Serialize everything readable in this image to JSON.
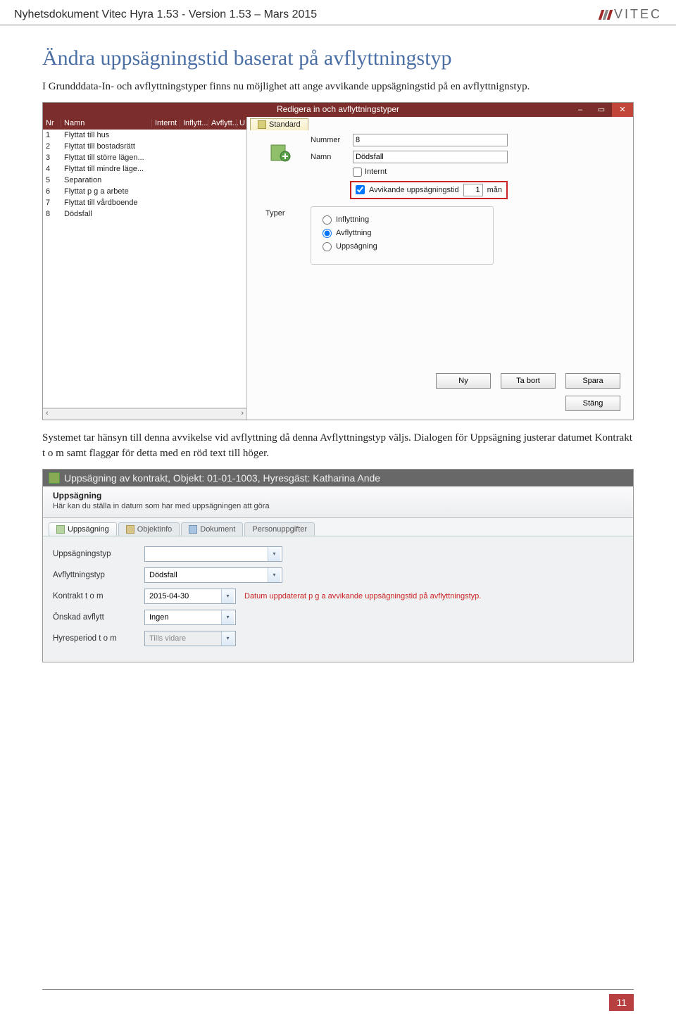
{
  "header": {
    "doc_title": "Nyhetsdokument Vitec Hyra 1.53 - Version 1.53 – Mars 2015",
    "logo_text": "VITEC"
  },
  "section_title": "Ändra uppsägningstid baserat på avflyttningstyp",
  "intro_text": "I Grundddata-In- och avflyttningstyper finns nu möjlighet att ange avvikande uppsägningstid på en avflyttnignstyp.",
  "shot1": {
    "title": "Redigera in och avflyttningstyper",
    "cols": {
      "nr": "Nr",
      "namn": "Namn",
      "internt": "Internt",
      "inflytt": "Inflytt...",
      "avflytt": "Avflytt...",
      "u": "U"
    },
    "rows": [
      {
        "nr": "1",
        "namn": "Flyttat till hus"
      },
      {
        "nr": "2",
        "namn": "Flyttat till bostadsrätt"
      },
      {
        "nr": "3",
        "namn": "Flyttat till större lägen..."
      },
      {
        "nr": "4",
        "namn": "Flyttat till mindre läge..."
      },
      {
        "nr": "5",
        "namn": "Separation"
      },
      {
        "nr": "6",
        "namn": "Flyttat p g a arbete"
      },
      {
        "nr": "7",
        "namn": "Flyttat till vårdboende"
      },
      {
        "nr": "8",
        "namn": "Dödsfall"
      }
    ],
    "tab": "Standard",
    "form": {
      "nummer_label": "Nummer",
      "nummer_value": "8",
      "namn_label": "Namn",
      "namn_value": "Dödsfall",
      "internt_label": "Internt",
      "avvikande_label": "Avvikande uppsägningstid",
      "avvikande_value": "1",
      "avvikande_unit": "mån",
      "typer_label": "Typer",
      "radios": {
        "inflytt": "Inflyttning",
        "avflytt": "Avflyttning",
        "uppsag": "Uppsägning"
      }
    },
    "buttons": {
      "ny": "Ny",
      "tabort": "Ta bort",
      "spara": "Spara",
      "stang": "Stäng"
    }
  },
  "mid_text": "Systemet tar hänsyn till denna avvikelse vid avflyttning då denna Avflyttningstyp väljs. Dialogen för Uppsägning justerar datumet Kontrakt t o m samt flaggar för detta med en röd text till höger.",
  "shot2": {
    "title": "Uppsägning av kontrakt, Objekt: 01-01-1003, Hyresgäst: Katharina Ande",
    "panel_title": "Uppsägning",
    "panel_desc": "Här kan du ställa in datum som har med uppsägningen att göra",
    "tabs": {
      "uppsagning": "Uppsägning",
      "objektinfo": "Objektinfo",
      "dokument": "Dokument",
      "person": "Personuppgifter"
    },
    "rows": {
      "uppsagningstyp": "Uppsägningstyp",
      "avflyttningstyp": "Avflyttningstyp",
      "avflyttningstyp_val": "Dödsfall",
      "kontrakt": "Kontrakt t o m",
      "kontrakt_val": "2015-04-30",
      "kontrakt_note": "Datum uppdaterat p g a avvikande uppsägningstid på avflyttningstyp.",
      "onskad": "Önskad avflytt",
      "onskad_val": "Ingen",
      "hyresperiod": "Hyresperiod t o m",
      "hyresperiod_val": "Tills vidare"
    }
  },
  "page_number": "11"
}
